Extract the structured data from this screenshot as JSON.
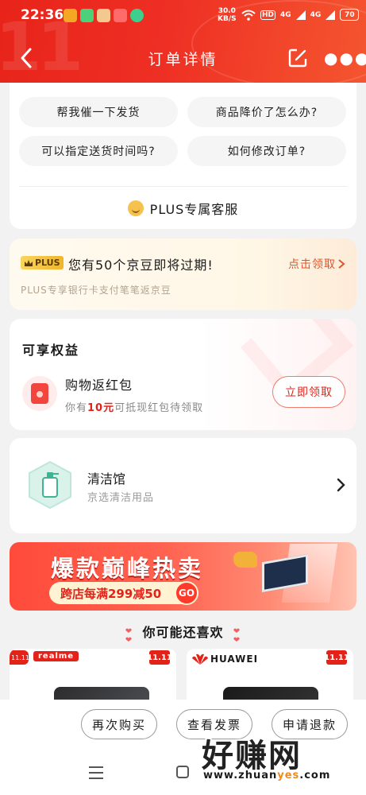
{
  "status_bar": {
    "time": "22:36",
    "net_speed_value": "30.0",
    "net_speed_unit": "KB/S",
    "hd_label": "HD",
    "signal1_label": "4G",
    "signal2_label": "4G",
    "battery": "70"
  },
  "header": {
    "title": "订单详情"
  },
  "faq": {
    "questions": [
      "帮我催一下发货",
      "商品降价了怎么办?",
      "可以指定送货时间吗?",
      "如何修改订单?"
    ],
    "service_label": "PLUS专属客服"
  },
  "jd_bean": {
    "badge": "PLUS",
    "title": "您有50个京豆即将过期!",
    "subtitle": "PLUS专享银行卡支付笔笔返京豆",
    "action": "点击领取"
  },
  "rights": {
    "title": "可享权益",
    "item_title": "购物返红包",
    "desc_prefix": "你有",
    "desc_amount": "10元",
    "desc_suffix": "可抵现红包待领取",
    "button": "立即领取"
  },
  "store": {
    "name": "清洁馆",
    "desc": "京选清洁用品"
  },
  "banner": {
    "title": "爆款巅峰热卖",
    "promo": "跨店每满299减50",
    "go": "GO"
  },
  "recommend": {
    "title": "你可能还喜欢",
    "products": [
      {
        "tag": "11.11",
        "brand": "realme",
        "promo": "11.11"
      },
      {
        "tag": "",
        "brand": "HUAWEI",
        "promo": "11.11"
      }
    ]
  },
  "bottom_bar": {
    "buttons": [
      "再次购买",
      "查看发票",
      "申请退款"
    ]
  },
  "watermark": {
    "title": "好赚网",
    "url_prefix": "www.zhuan",
    "url_highlight": "yes",
    "url_suffix": ".com"
  },
  "colors": {
    "brand_red": "#e3231a",
    "header_red": "#ee2f24",
    "plus_gold": "#f1b52c"
  }
}
